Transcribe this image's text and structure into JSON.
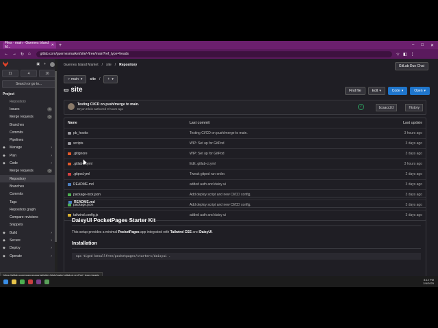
{
  "browser": {
    "tab_title": "Files · main · Guernes Island M...",
    "url": "gitlab.com/guernesmarket/site/-/tree/main?ref_type=heads",
    "status_url": "https://gitlab.com/guernesmarket/site/-/blob/main/.gitlab-ci.yml?ref_type=heads"
  },
  "sidebar": {
    "counters": [
      "11",
      "4",
      "16"
    ],
    "search_label": "Search or go to...",
    "section_label": "Project",
    "items": [
      {
        "label": "Repository",
        "kind": "sub",
        "dim": true
      },
      {
        "label": "Issues",
        "kind": "sub",
        "badge": "0"
      },
      {
        "label": "Merge requests",
        "kind": "sub",
        "badge": "0"
      },
      {
        "label": "Branches",
        "kind": "sub"
      },
      {
        "label": "Commits",
        "kind": "sub"
      },
      {
        "label": "Pipelines",
        "kind": "sub"
      },
      {
        "label": "Manage",
        "kind": "group"
      },
      {
        "label": "Plan",
        "kind": "group"
      },
      {
        "label": "Code",
        "kind": "group"
      },
      {
        "label": "Merge requests",
        "kind": "sub",
        "badge": "0"
      },
      {
        "label": "Repository",
        "kind": "sub",
        "active": true
      },
      {
        "label": "Branches",
        "kind": "sub"
      },
      {
        "label": "Commits",
        "kind": "sub"
      },
      {
        "label": "Tags",
        "kind": "sub"
      },
      {
        "label": "Repository graph",
        "kind": "sub"
      },
      {
        "label": "Compare revisions",
        "kind": "sub"
      },
      {
        "label": "Snippets",
        "kind": "sub"
      },
      {
        "label": "Build",
        "kind": "group"
      },
      {
        "label": "Secure",
        "kind": "group"
      },
      {
        "label": "Deploy",
        "kind": "group"
      },
      {
        "label": "Operate",
        "kind": "group"
      }
    ]
  },
  "breadcrumb": [
    "Guernes Island Market",
    "site",
    "Repository"
  ],
  "duo_chat": "GitLab Duo Chat",
  "branch": "main",
  "path_root": "site",
  "add_symbol": "+",
  "page_title": "site",
  "actions": {
    "find_file": "Find file",
    "edit": "Edit",
    "code": "Code",
    "open": "Open"
  },
  "commit": {
    "message": "Testing CI/CD on push/merge to main.",
    "author": "Bryon Klein authored 3 hours ago",
    "sha": "bcaacc2d",
    "history": "History"
  },
  "files": {
    "headers": {
      "name": "Name",
      "commit": "Last commit",
      "update": "Last update"
    },
    "rows": [
      {
        "name": "pb_hooks",
        "icon": "folder",
        "commit": "Testing CI/CD on push/merge to main.",
        "update": "3 hours ago"
      },
      {
        "name": "scripts",
        "icon": "folder",
        "commit": "WIP: Set up for GitPod",
        "update": "3 days ago"
      },
      {
        "name": ".gitignore",
        "icon": "orange",
        "commit": "WIP: Set up for GitPod",
        "update": "3 days ago"
      },
      {
        "name": ".gitlab-ci.yml",
        "icon": "orange",
        "commit": "Edit .gitlab-ci.yml",
        "update": "3 hours ago"
      },
      {
        "name": ".gitpod.yml",
        "icon": "red",
        "commit": "Tweak gitpod run order.",
        "update": "2 days ago"
      },
      {
        "name": "README.md",
        "icon": "blue",
        "commit": "added auth and daisy ui",
        "update": "3 days ago"
      },
      {
        "name": "package-lock.json",
        "icon": "green",
        "commit": "Add deploy script and new CI/CD config.",
        "update": "3 days ago"
      },
      {
        "name": "package.json",
        "icon": "green",
        "commit": "Add deploy script and new CI/CD config.",
        "update": "3 days ago"
      },
      {
        "name": "tailwind.config.js",
        "icon": "yellow",
        "commit": "added auth and daisy ui",
        "update": "3 days ago"
      }
    ]
  },
  "readme": {
    "file": "README.md",
    "h1": "DaisyUI PocketPages Starter Kit",
    "p_pre": "This setup provides a minimal ",
    "p_b1": "PocketPages",
    "p_mid": " app integrated with ",
    "p_b2": "Tailwind CSS",
    "p_and": " and ",
    "p_b3": "DaisyUI",
    "p_end": ".",
    "h2": "Installation",
    "code": "npx tiged benallfree/pocketpages/starters/daisyui ."
  },
  "taskbar": {
    "time": "8:12 PM",
    "date": "2/6/2025"
  }
}
